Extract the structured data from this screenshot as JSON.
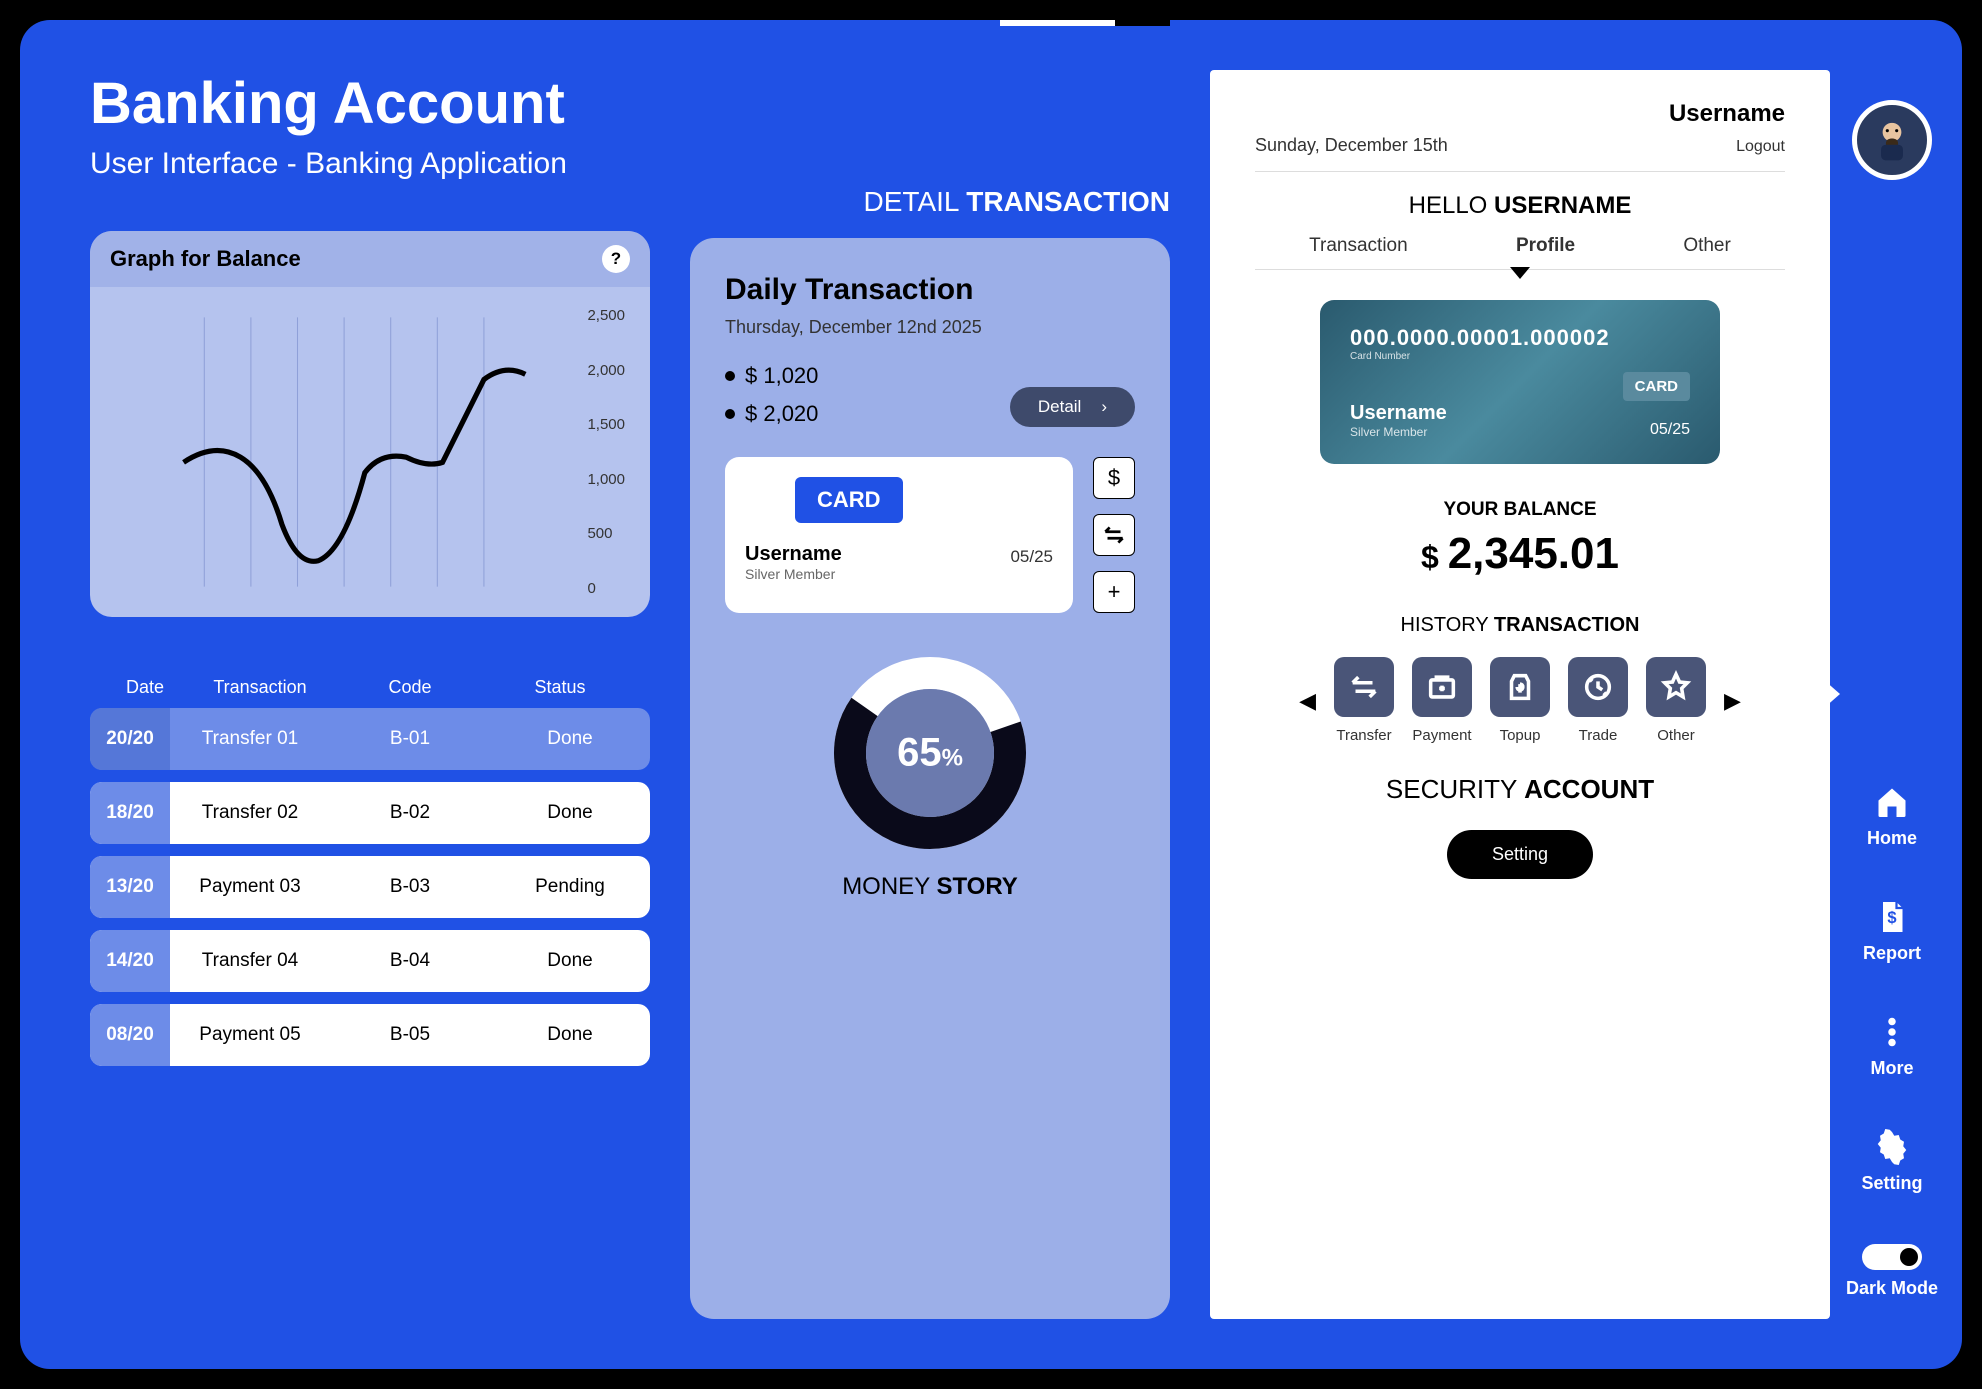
{
  "header": {
    "title": "Banking Account",
    "subtitle": "User Interface - Banking Application"
  },
  "chart_data": {
    "type": "line",
    "title": "Graph for Balance",
    "ylim": [
      0,
      2500
    ],
    "yticks": [
      "2,500",
      "2,000",
      "1,500",
      "1,000",
      "500",
      "0"
    ],
    "x": [
      0,
      1,
      2,
      3,
      4,
      5,
      6,
      7,
      8,
      9
    ],
    "values": [
      1100,
      1150,
      1000,
      500,
      600,
      1100,
      1150,
      1100,
      1900,
      1800
    ]
  },
  "tx_table": {
    "headers": {
      "date": "Date",
      "transaction": "Transaction",
      "code": "Code",
      "status": "Status"
    },
    "rows": [
      {
        "date": "20/20",
        "name": "Transfer 01",
        "code": "B-01",
        "status": "Done",
        "active": true
      },
      {
        "date": "18/20",
        "name": "Transfer 02",
        "code": "B-02",
        "status": "Done"
      },
      {
        "date": "13/20",
        "name": "Payment 03",
        "code": "B-03",
        "status": "Pending"
      },
      {
        "date": "14/20",
        "name": "Transfer 04",
        "code": "B-04",
        "status": "Done"
      },
      {
        "date": "08/20",
        "name": "Payment 05",
        "code": "B-05",
        "status": "Done"
      }
    ]
  },
  "detail": {
    "label_pre": "DETAIL ",
    "label_bold": "TRANSACTION"
  },
  "daily": {
    "title": "Daily Transaction",
    "date": "Thursday, December 12nd 2025",
    "amounts": [
      "$ 1,020",
      "$ 2,020"
    ],
    "detail_btn": "Detail",
    "card_badge": "CARD",
    "card_user": "Username",
    "card_sub": "Silver Member",
    "card_exp": "05/25",
    "donut_pct": "65",
    "money_story_pre": "MONEY ",
    "money_story_bold": "STORY"
  },
  "profile": {
    "username_top": "Username",
    "logout": "Logout",
    "date": "Sunday, December 15th",
    "hello_pre": "HELLO ",
    "hello_bold": "USERNAME",
    "tabs": [
      "Transaction",
      "Profile",
      "Other"
    ],
    "card": {
      "number": "000.0000.00001.000002",
      "label": "Card Number",
      "badge": "CARD",
      "name": "Username",
      "sub": "Silver Member",
      "exp": "05/25"
    },
    "balance_label": "YOUR BALANCE",
    "balance_amount": "2,345.01",
    "history_pre": "HISTORY ",
    "history_bold": "TRANSACTION",
    "actions": [
      "Transfer",
      "Payment",
      "Topup",
      "Trade",
      "Other"
    ],
    "security_pre": "SECURITY ",
    "security_bold": "ACCOUNT",
    "setting_btn": "Setting"
  },
  "nav": {
    "items": [
      "Home",
      "Report",
      "More",
      "Setting",
      "Dark Mode"
    ]
  }
}
